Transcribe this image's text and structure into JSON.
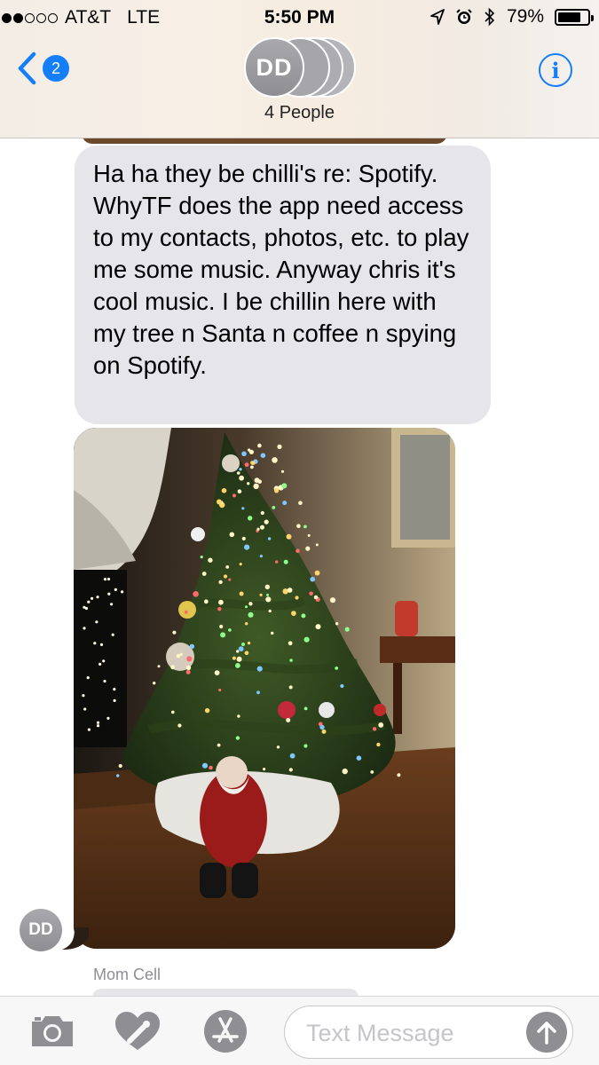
{
  "status_bar": {
    "carrier": "AT&T",
    "network": "LTE",
    "time": "5:50 PM",
    "battery": "79%",
    "battery_level": 0.79,
    "signal_bars": 2,
    "signal_total": 5,
    "icons": [
      "location-icon",
      "alarm-icon",
      "bluetooth-icon",
      "battery-icon"
    ]
  },
  "header": {
    "back_badge": "2",
    "avatar_initials": "DD",
    "group_name": "4 People",
    "accent_color": "#147efb"
  },
  "messages": [
    {
      "type": "text",
      "text": "Ha ha they be chilli's re: Spotify. WhyTF does the app need access to my contacts, photos, etc. to play me some music. Anyway chris it's cool music. I be chillin here with my tree n Santa n coffee n spying on Spotify."
    },
    {
      "type": "image",
      "subject": "christmas-tree-photo",
      "sender_initials": "DD"
    }
  ],
  "next_sender": "Mom Cell",
  "input": {
    "placeholder": "Text Message",
    "value": "",
    "tools": [
      "camera-icon",
      "digital-touch-icon",
      "app-store-icon",
      "send-arrow-icon"
    ]
  },
  "colors": {
    "received_bubble": "#e5e5ea",
    "avatar_gray": "#9b9aa0"
  }
}
